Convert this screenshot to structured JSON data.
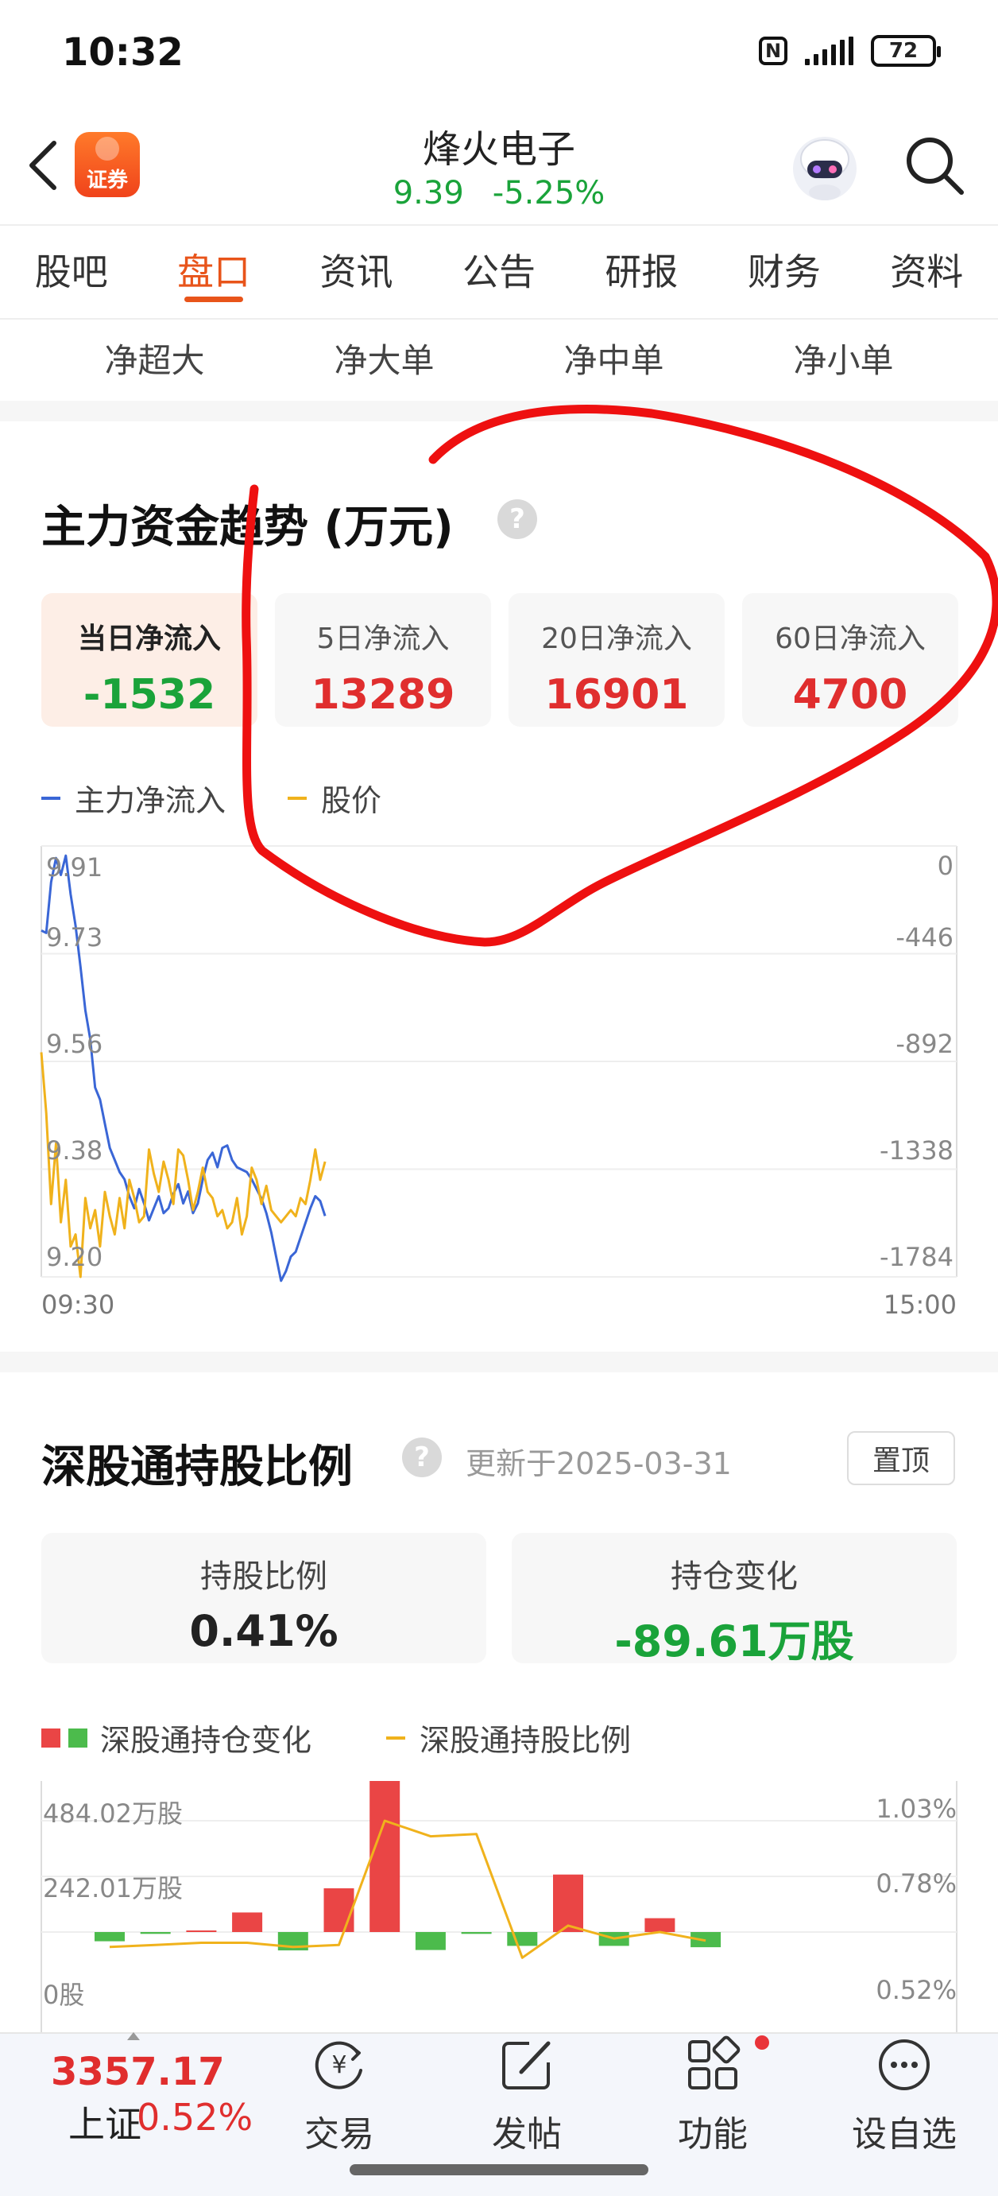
{
  "status_bar": {
    "time": "10:32",
    "nfc": "N",
    "battery": "72"
  },
  "header": {
    "logo_text": "证券",
    "stock_name": "烽火电子",
    "price": "9.39",
    "change_pct": "-5.25%"
  },
  "tabs": [
    "股吧",
    "盘口",
    "资讯",
    "公告",
    "研报",
    "财务",
    "资料"
  ],
  "active_tab": "盘口",
  "subtabs": [
    "净超大",
    "净大单",
    "净中单",
    "净小单"
  ],
  "main_flow": {
    "title": "主力资金趋势 (万元)",
    "help": "?",
    "cards": [
      {
        "label": "当日净流入",
        "value": "-1532",
        "color": "#1aa33a"
      },
      {
        "label": "5日净流入",
        "value": "13289",
        "color": "#e02e2e"
      },
      {
        "label": "20日净流入",
        "value": "16901",
        "color": "#e02e2e"
      },
      {
        "label": "60日净流入",
        "value": "4700",
        "color": "#e02e2e"
      }
    ],
    "legend": [
      {
        "name": "主力净流入",
        "color": "#3a66d6"
      },
      {
        "name": "股价",
        "color": "#f0b21c"
      }
    ],
    "left_axis": [
      "9.91",
      "9.73",
      "9.56",
      "9.38",
      "9.20"
    ],
    "right_axis": [
      "0",
      "-446",
      "-892",
      "-1338",
      "-1784"
    ],
    "x_start": "09:30",
    "x_end": "15:00"
  },
  "chart_data": [
    {
      "type": "line",
      "title": "主力资金趋势 (万元)",
      "x_range": [
        "09:30",
        "15:00"
      ],
      "series": [
        {
          "name": "主力净流入",
          "axis": "right",
          "ylim": [
            -1784,
            0
          ],
          "values": [
            -350,
            -360,
            -150,
            -50,
            -120,
            -40,
            -200,
            -330,
            -500,
            -680,
            -800,
            -1000,
            -1050,
            -1150,
            -1250,
            -1300,
            -1350,
            -1380,
            -1450,
            -1500,
            -1420,
            -1480,
            -1550,
            -1500,
            -1450,
            -1520,
            -1500,
            -1440,
            -1400,
            -1480,
            -1430,
            -1520,
            -1480,
            -1380,
            -1300,
            -1270,
            -1330,
            -1250,
            -1240,
            -1300,
            -1330,
            -1340,
            -1350,
            -1380,
            -1420,
            -1460,
            -1520,
            -1600,
            -1700,
            -1800,
            -1760,
            -1700,
            -1680,
            -1620,
            -1560,
            -1500,
            -1450,
            -1470,
            -1532
          ]
        },
        {
          "name": "股价",
          "axis": "left",
          "ylim": [
            9.2,
            9.91
          ],
          "values": [
            9.57,
            9.47,
            9.32,
            9.42,
            9.29,
            9.36,
            9.25,
            9.27,
            9.2,
            9.33,
            9.28,
            9.31,
            9.25,
            9.34,
            9.3,
            9.27,
            9.33,
            9.28,
            9.36,
            9.33,
            9.29,
            9.3,
            9.41,
            9.37,
            9.34,
            9.39,
            9.36,
            9.32,
            9.41,
            9.4,
            9.36,
            9.31,
            9.34,
            9.38,
            9.34,
            9.33,
            9.3,
            9.31,
            9.28,
            9.29,
            9.33,
            9.27,
            9.3,
            9.38,
            9.36,
            9.32,
            9.35,
            9.31,
            9.3,
            9.29,
            9.3,
            9.31,
            9.3,
            9.33,
            9.32,
            9.36,
            9.41,
            9.36,
            9.39
          ]
        }
      ]
    },
    {
      "type": "bar",
      "title": "深股通持股比例",
      "left_axis_ticks": [
        "484.02万股",
        "242.01万股",
        "0股"
      ],
      "right_axis_ticks": [
        "1.03%",
        "0.78%",
        "0.52%"
      ],
      "series": [
        {
          "name": "深股通持仓变化",
          "unit": "万股",
          "values": [
            -40,
            -8,
            0,
            85,
            -80,
            190,
            693,
            -78,
            -8,
            -60,
            250,
            -60,
            60,
            -66
          ]
        },
        {
          "name": "深股通持股比例",
          "unit": "%",
          "values": [
            0.45,
            0.46,
            0.47,
            0.47,
            0.45,
            0.46,
            1.03,
            0.96,
            0.97,
            0.4,
            0.55,
            0.49,
            0.52,
            0.48
          ]
        }
      ]
    }
  ],
  "sgt": {
    "title": "深股通持股比例",
    "help": "?",
    "update": "更新于2025-03-31",
    "pin": "置顶",
    "cards": [
      {
        "label": "持股比例",
        "value": "0.41%",
        "color": "#222222"
      },
      {
        "label": "持仓变化",
        "value": "-89.61万股",
        "color": "#1aa33a"
      }
    ],
    "legend_bar": "深股通持仓变化",
    "legend_line": "深股通持股比例"
  },
  "bottom_bar": {
    "index_value": "3357.17",
    "index_name": "上证",
    "index_change": "0.52%",
    "items": [
      "交易",
      "发帖",
      "功能",
      "设自选"
    ]
  },
  "colors": {
    "up": "#e02e2e",
    "down": "#1aa33a",
    "accent": "#e8541a",
    "annotation": "#ee1010",
    "bar_red": "#ea4545",
    "bar_green": "#4cbb4c",
    "line_blue": "#3a66d6",
    "line_gold": "#f0b21c"
  }
}
